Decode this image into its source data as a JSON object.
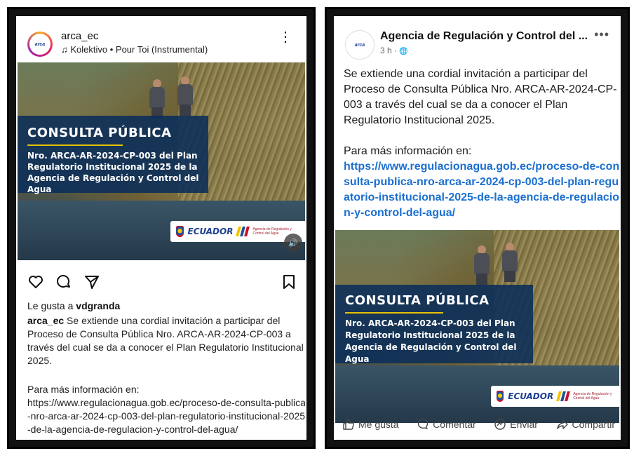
{
  "instagram": {
    "avatar_text": "arca",
    "username": "arca_ec",
    "music": "Kolektivo • Pour Toi (Instrumental)",
    "more_glyph": "⋮",
    "image": {
      "title": "CONSULTA PÚBLICA",
      "subtitle": "Nro. ARCA-AR-2024-CP-003 del Plan Regulatorio Institucional 2025 de la Agencia de Regulación y Control del Agua",
      "logo_text": "ECUADOR",
      "agency_text": "Agencia de Regulación y Control del Agua"
    },
    "likes_prefix": "Le gusta a ",
    "likes_user": "vdgranda",
    "caption_user": "arca_ec",
    "caption": " Se extiende una cordial invitación a participar del Proceso de Consulta Pública Nro. ARCA-AR-2024-CP-003 a través del cual se da a conocer el Plan Regulatorio Institucional 2025.",
    "more_info_label": "Para más información en:",
    "more_info_url": "https://www.regulacionagua.gob.ec/proceso-de-consulta-publica-nro-arca-ar-2024-cp-003-del-plan-regulatorio-institucional-2025-de-la-agencia-de-regulacion-y-control-del-agua/"
  },
  "facebook": {
    "avatar_text": "arca",
    "page_name": "Agencia de Regulación y Control del ...",
    "time": "3 h · ",
    "globe_glyph": "🌐",
    "more_glyph": "•••",
    "text": "Se extiende una cordial invitación a participar del Proceso de Consulta Pública Nro. ARCA-AR-2024-CP-003 a través del cual se da a conocer el Plan Regulatorio Institucional 2025.",
    "more_info_label": "Para más información en:",
    "more_info_url": "https://www.regulacionagua.gob.ec/proceso-de-consulta-publica-nro-arca-ar-2024-cp-003-del-plan-regulatorio-institucional-2025-de-la-agencia-de-regulacion-y-control-del-agua/",
    "image": {
      "title": "CONSULTA PÚBLICA",
      "subtitle": "Nro. ARCA-AR-2024-CP-003 del Plan Regulatorio Institucional 2025 de la Agencia de Regulación y Control del Agua",
      "logo_text": "ECUADOR",
      "agency_text": "Agencia de Regulación y Control del Agua"
    },
    "actions": {
      "like": "Me gusta",
      "comment": "Comentar",
      "send": "Enviar",
      "share": "Compartir"
    }
  },
  "colors": {
    "flag_yellow": "#f2c500",
    "flag_blue": "#1f4f9a",
    "flag_red": "#c8102e",
    "link_blue": "#1b6fd0",
    "banner_blue": "#0a2d5a"
  }
}
